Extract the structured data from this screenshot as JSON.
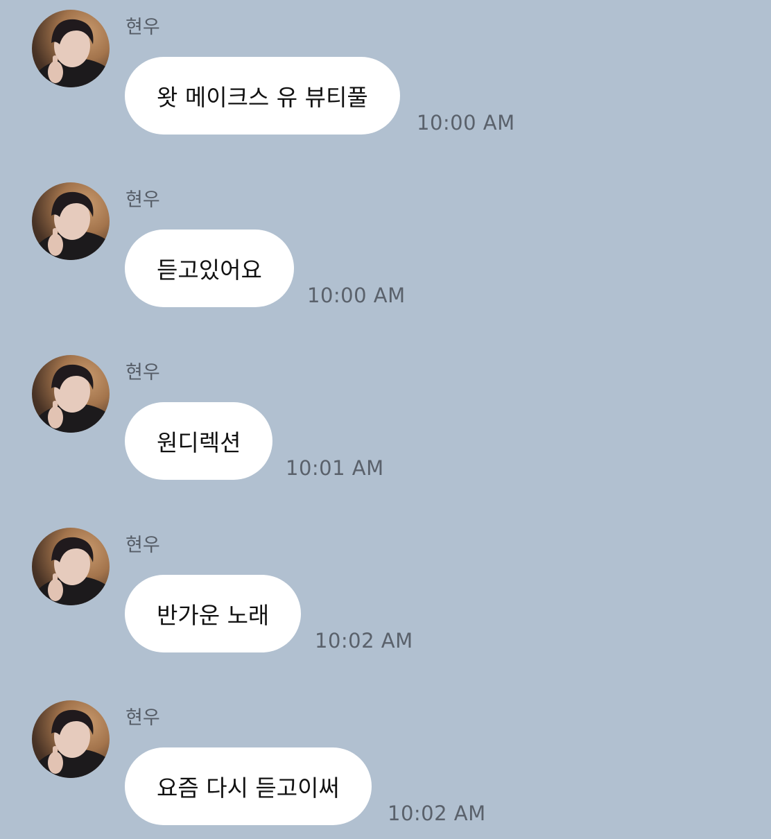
{
  "chat": {
    "messages": [
      {
        "sender": "현우",
        "text": "왓 메이크스 유 뷰티풀",
        "time": "10:00 AM"
      },
      {
        "sender": "현우",
        "text": "듣고있어요",
        "time": "10:00 AM"
      },
      {
        "sender": "현우",
        "text": "원디렉션",
        "time": "10:01 AM"
      },
      {
        "sender": "현우",
        "text": "반가운 노래",
        "time": "10:02 AM"
      },
      {
        "sender": "현우",
        "text": "요즘 다시 듣고이써",
        "time": "10:02 AM"
      }
    ]
  },
  "colors": {
    "background": "#b1c0d0",
    "bubble": "#ffffff",
    "sender_text": "#555c66",
    "time_text": "#5a616b"
  },
  "icons": {
    "avatar": "profile-photo"
  }
}
